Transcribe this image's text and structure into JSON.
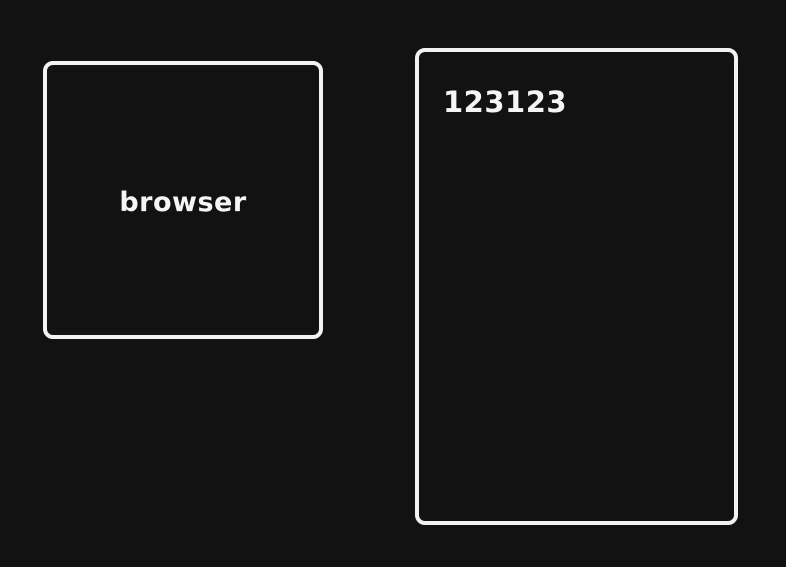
{
  "shapes": {
    "browser_box": {
      "label": "browser"
    },
    "content_box": {
      "label": "123123"
    }
  },
  "colors": {
    "background": "#121212",
    "stroke": "#f2f2f2",
    "text": "#f5f5f5"
  }
}
